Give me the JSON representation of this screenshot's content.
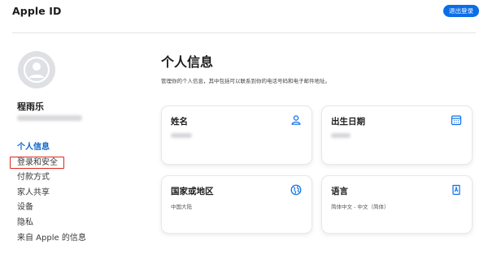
{
  "header": {
    "title": "Apple ID",
    "sign_out_label": "退出登录"
  },
  "profile": {
    "name": "程雨乐"
  },
  "sidebar": {
    "items": [
      {
        "label": "个人信息",
        "active": true
      },
      {
        "label": "登录和安全",
        "active": false,
        "highlighted": true
      },
      {
        "label": "付款方式",
        "active": false
      },
      {
        "label": "家人共享",
        "active": false
      },
      {
        "label": "设备",
        "active": false
      },
      {
        "label": "隐私",
        "active": false
      },
      {
        "label": "来自 Apple 的信息",
        "active": false
      }
    ]
  },
  "main": {
    "title": "个人信息",
    "description": "管理你的个人信息，其中包括可以联系到你的电话号码和电子邮件地址。",
    "cards": [
      {
        "title": "姓名",
        "value": "",
        "icon": "person-icon"
      },
      {
        "title": "出生日期",
        "value": "",
        "icon": "calendar-icon"
      },
      {
        "title": "国家或地区",
        "value": "中国大陆",
        "icon": "globe-icon"
      },
      {
        "title": "语言",
        "value": "简体中文 - 中文（简体）",
        "icon": "language-book-icon"
      }
    ]
  },
  "colors": {
    "accent": "#0a6ee8",
    "active_nav": "#0a66c8",
    "highlight_border": "#e0251c"
  }
}
